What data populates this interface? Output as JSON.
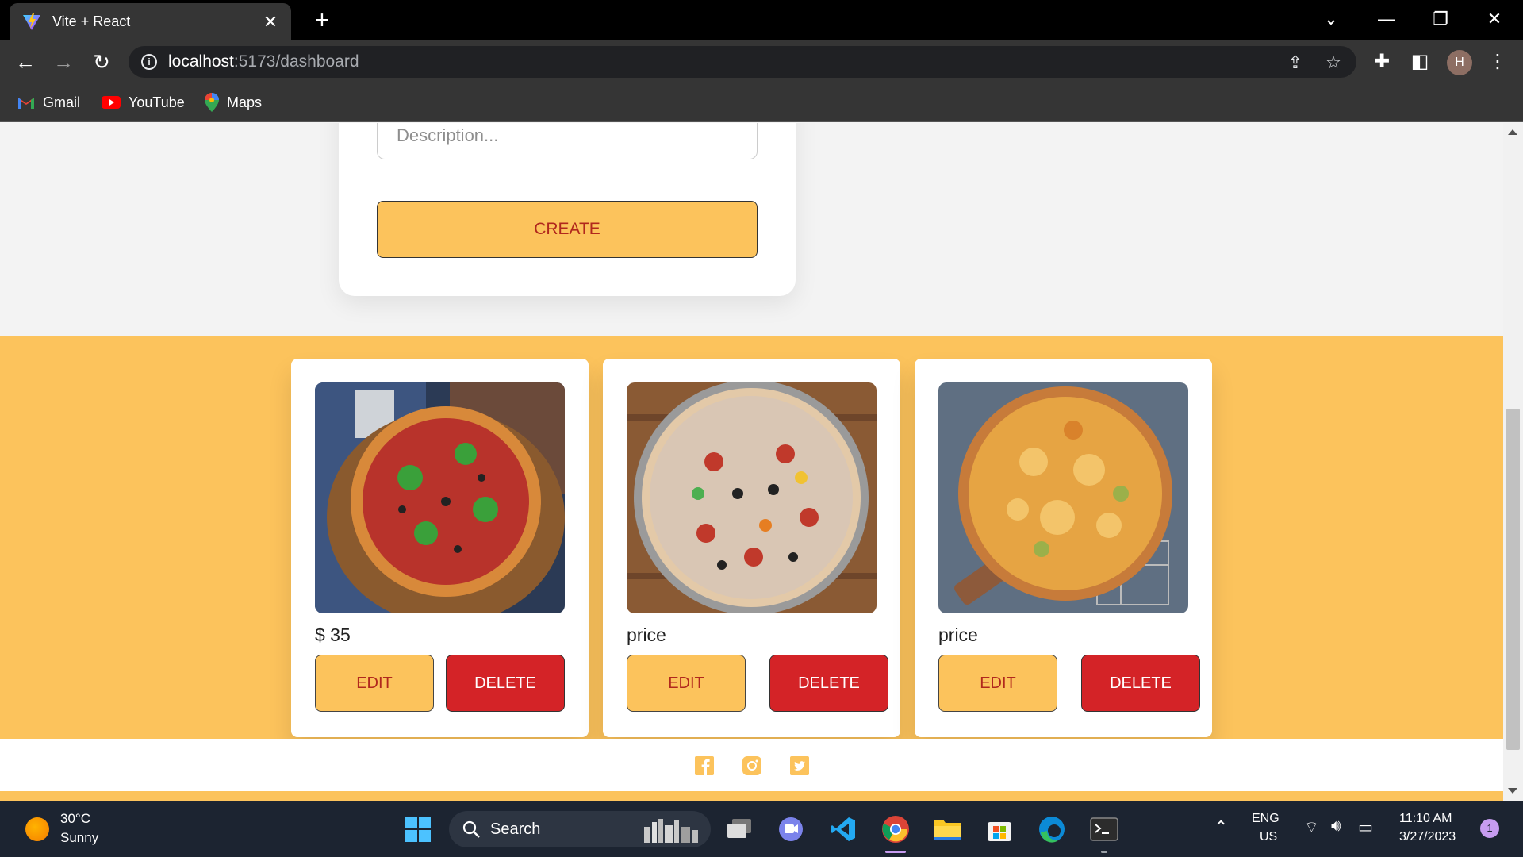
{
  "browser": {
    "tab_title": "Vite + React",
    "url_host": "localhost",
    "url_path": ":5173/dashboard",
    "profile_initial": "H",
    "bookmarks": [
      {
        "label": "Gmail",
        "icon": "gmail-icon"
      },
      {
        "label": "YouTube",
        "icon": "youtube-icon"
      },
      {
        "label": "Maps",
        "icon": "maps-icon"
      }
    ]
  },
  "form": {
    "description_placeholder": "Description...",
    "description_value": "",
    "create_label": "CREATE"
  },
  "products": [
    {
      "price": "$ 35",
      "image": "pizza-basil-on-wooden-board",
      "edit_label": "EDIT",
      "delete_label": "DELETE"
    },
    {
      "price": "price",
      "image": "pizza-mixed-toppings-on-pan",
      "edit_label": "EDIT",
      "delete_label": "DELETE"
    },
    {
      "price": "price",
      "image": "pizza-cheese-on-rack",
      "edit_label": "EDIT",
      "delete_label": "DELETE"
    }
  ],
  "footer": {
    "social_icons": [
      "facebook-icon",
      "instagram-icon",
      "twitter-icon"
    ]
  },
  "taskbar": {
    "weather_temp": "30°C",
    "weather_desc": "Sunny",
    "search_label": "Search",
    "language_line1": "ENG",
    "language_line2": "US",
    "time": "11:10 AM",
    "date": "3/27/2023",
    "notification_count": "1"
  },
  "colors": {
    "accent_yellow": "#fcc35c",
    "delete_red": "#d42327",
    "button_text_red": "#b1281d"
  }
}
